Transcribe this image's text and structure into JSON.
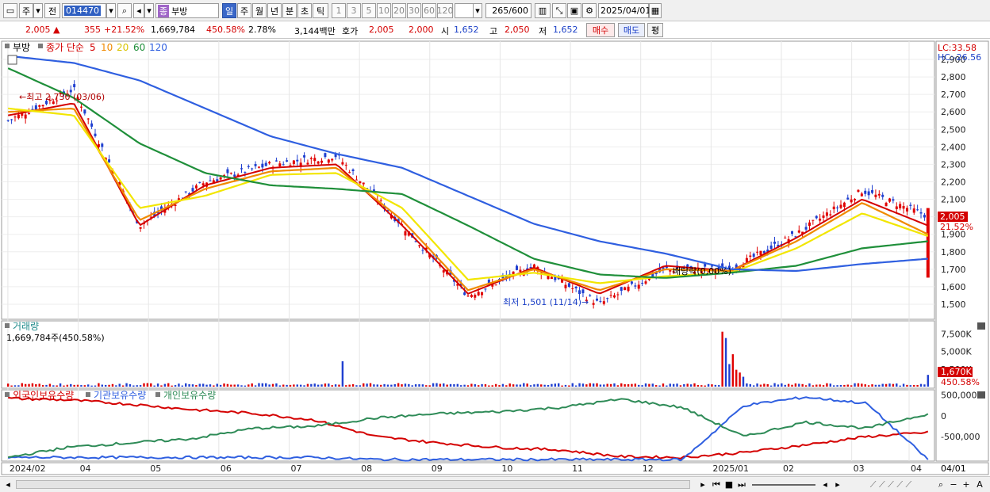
{
  "toolbar": {
    "market": "주",
    "prev_label": "전",
    "code": "014470",
    "name_badge": "종",
    "name": "부방",
    "periods": [
      "일",
      "주",
      "월",
      "년",
      "분",
      "초",
      "틱"
    ],
    "intervals": [
      "1",
      "3",
      "5",
      "10",
      "20",
      "30",
      "60",
      "120"
    ],
    "count": "265",
    "count_total": "/600",
    "date": "2025/04/01"
  },
  "quote": {
    "price": "2,005",
    "arrow": "▲",
    "change": "355",
    "change_pct": "+21.52%",
    "volume": "1,669,784",
    "volume_pct": "450.58%",
    "turnover": "2.78%",
    "amount": "3,144백만",
    "ask_label": "호가",
    "ask1": "2,005",
    "ask2": "2,000",
    "open_label": "시",
    "open": "1,652",
    "high_label": "고",
    "high": "2,050",
    "low_label": "저",
    "low": "1,652",
    "buy_label": "매수",
    "sell_label": "매도",
    "eval_label": "평"
  },
  "price_panel": {
    "legend_name": "부방",
    "legend_ma_label": "종가 단순",
    "ma_periods": [
      "5",
      "10",
      "20",
      "60",
      "120"
    ],
    "ma_colors": [
      "#d40000",
      "#f08a00",
      "#f2e600",
      "#1f8f3a",
      "#2f5fe0"
    ],
    "lc": "LC:33.58",
    "hc": "HC:-26.56",
    "y_ticks": [
      "2,900",
      "2,800",
      "2,700",
      "2,600",
      "2,500",
      "2,400",
      "2,300",
      "2,200",
      "2,100",
      "2,000",
      "1,900",
      "1,800",
      "1,700",
      "1,600",
      "1,500"
    ],
    "current_tag": "2,005",
    "current_pct": "21.52%",
    "high_annotation": "최고 2,730 (03/06)",
    "low_annotation": "최저 1,501 (11/14)",
    "mid_annotation": "배당락(0,00%)"
  },
  "volume_panel": {
    "title": "거래량",
    "value": "1,669,784주(450.58%)",
    "y_ticks": [
      "7,500K",
      "5,000K",
      "2,500K"
    ],
    "current_tag": "1,670K",
    "current_pct": "450.58%"
  },
  "holding_panel": {
    "legends": [
      "외국인보유수량",
      "기관보유수량",
      "개인보유수량"
    ],
    "legend_colors": [
      "#d40000",
      "#2f5fe0",
      "#2e8b57"
    ],
    "y_ticks": [
      "500,000",
      "0",
      "-500,000"
    ]
  },
  "x_axis": {
    "labels": [
      "2024/02",
      "04",
      "05",
      "06",
      "07",
      "08",
      "09",
      "10",
      "11",
      "12",
      "2025/01",
      "02",
      "03",
      "04"
    ],
    "right_label": "04/01"
  },
  "chart_data": {
    "type": "candlestick",
    "x": [
      "2024/02",
      "03",
      "04",
      "05",
      "06",
      "07",
      "08",
      "09",
      "10",
      "11",
      "12",
      "2025/01",
      "02",
      "03",
      "04"
    ],
    "ylim": [
      1450,
      2950
    ],
    "close_series": {
      "name": "부방",
      "x": [
        "2024/02",
        "2024/03/06",
        "2024/04",
        "2024/05",
        "2024/06",
        "2024/07",
        "2024/08",
        "2024/09",
        "2024/10",
        "2024/11/14",
        "2024/12",
        "2025/01",
        "2025/02",
        "2025/03",
        "2025/04/01"
      ],
      "values": [
        2550,
        2730,
        1950,
        2200,
        2300,
        2350,
        1950,
        1550,
        1720,
        1501,
        1700,
        1700,
        1900,
        2150,
        2005
      ]
    },
    "series": [
      {
        "name": "5",
        "values": [
          2580,
          2650,
          1950,
          2180,
          2280,
          2300,
          1950,
          1560,
          1710,
          1560,
          1720,
          1690,
          1880,
          2100,
          1950
        ]
      },
      {
        "name": "10",
        "values": [
          2600,
          2620,
          1980,
          2160,
          2260,
          2280,
          1980,
          1580,
          1700,
          1580,
          1700,
          1690,
          1860,
          2080,
          1900
        ]
      },
      {
        "name": "20",
        "values": [
          2620,
          2580,
          2050,
          2120,
          2240,
          2250,
          2050,
          1640,
          1680,
          1620,
          1660,
          1680,
          1820,
          2020,
          1890
        ]
      },
      {
        "name": "60",
        "values": [
          2850,
          2680,
          2420,
          2250,
          2180,
          2160,
          2130,
          1950,
          1760,
          1670,
          1650,
          1680,
          1720,
          1820,
          1860
        ]
      },
      {
        "name": "120",
        "values": [
          2920,
          2880,
          2780,
          2620,
          2460,
          2360,
          2280,
          2120,
          1960,
          1860,
          1790,
          1700,
          1690,
          1730,
          1760
        ]
      }
    ]
  }
}
